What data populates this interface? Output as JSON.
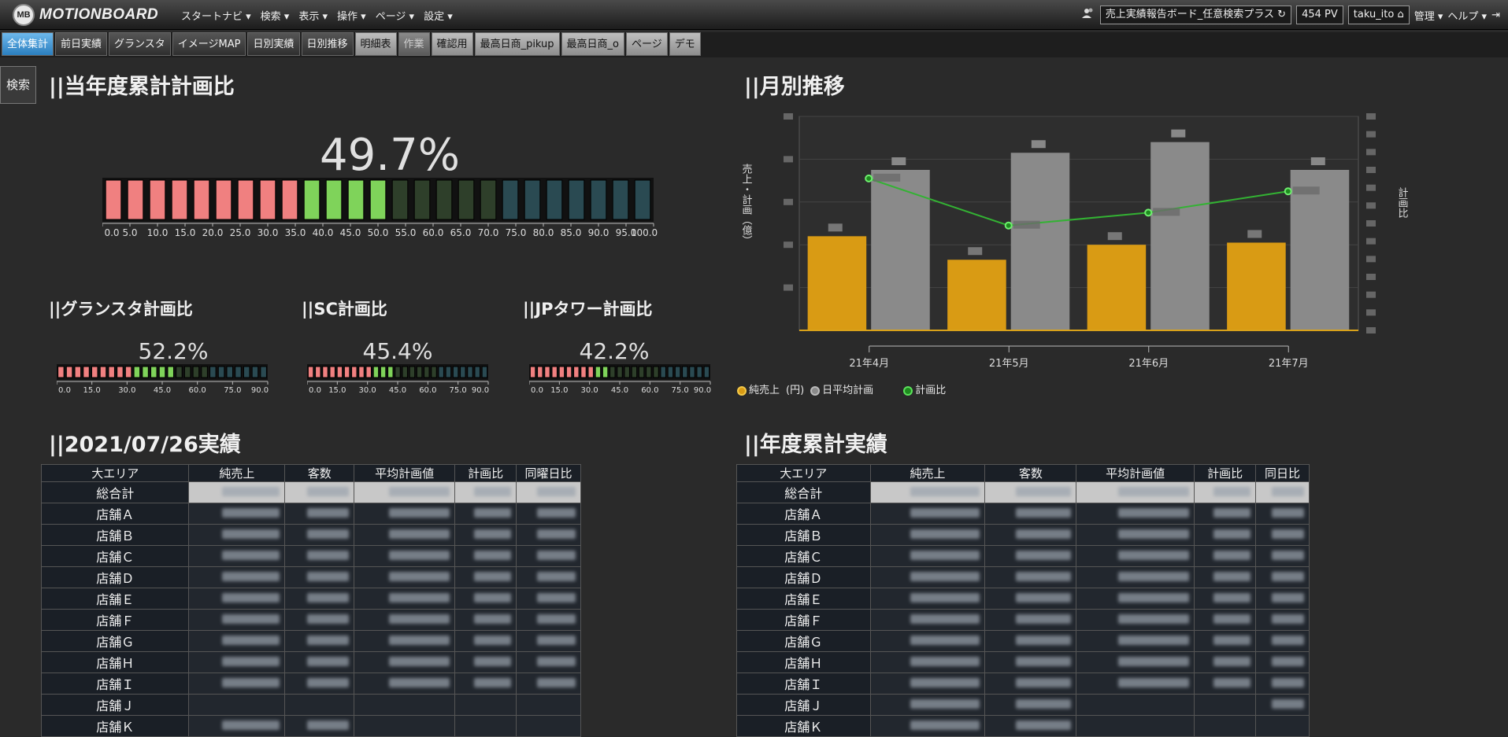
{
  "app": {
    "logo_mark": "MB",
    "logo_text": "MOTIONBOARD"
  },
  "topmenu": [
    "スタートナビ ▾",
    "検索 ▾",
    "表示 ▾",
    "操作 ▾",
    "ページ ▾",
    "設定 ▾"
  ],
  "topright": {
    "board_name": "売上実績報告ボード_任意検索プラス",
    "pv": "454 PV",
    "user": "taku_ito",
    "admin": "管理 ▾",
    "help": "ヘルプ ▾"
  },
  "tabs": [
    {
      "label": "全体集計",
      "style": "active"
    },
    {
      "label": "前日実績",
      "style": "dark"
    },
    {
      "label": "グランスタ",
      "style": "dark"
    },
    {
      "label": "イメージMAP",
      "style": "dark"
    },
    {
      "label": "日別実績",
      "style": "dark"
    },
    {
      "label": "日別推移",
      "style": "dark"
    },
    {
      "label": "明細表",
      "style": "light"
    },
    {
      "label": "作業",
      "style": "dim"
    },
    {
      "label": "確認用",
      "style": "light"
    },
    {
      "label": "最高日商_pikup",
      "style": "light"
    },
    {
      "label": "最高日商_o",
      "style": "light"
    },
    {
      "label": "ページ",
      "style": "light"
    },
    {
      "label": "デモ",
      "style": "light"
    }
  ],
  "search_button": "検索",
  "sections": {
    "ytd_plan": "||当年度累計計画比",
    "monthly": "||月別推移",
    "gransta": "||グランスタ計画比",
    "sc": "||SC計画比",
    "jp": "||JPタワー計画比",
    "daily": "||2021/07/26実績",
    "ytd_actual": "||年度累計実績"
  },
  "gauges": {
    "main": {
      "value": 49.7,
      "label": "49.7%"
    },
    "gransta": {
      "value": 52.2,
      "label": "52.2%"
    },
    "sc": {
      "value": 45.4,
      "label": "45.4%"
    },
    "jp": {
      "value": 42.2,
      "label": "42.2%"
    },
    "main_ticks": [
      "0.0",
      "5.0",
      "10.0",
      "15.0",
      "20.0",
      "25.0",
      "30.0",
      "35.0",
      "40.0",
      "45.0",
      "50.0",
      "55.0",
      "60.0",
      "65.0",
      "70.0",
      "75.0",
      "80.0",
      "85.0",
      "90.0",
      "95.0",
      "100.0"
    ],
    "small_ticks": [
      "0.0",
      "15.0",
      "30.0",
      "45.0",
      "60.0",
      "75.0",
      "90.0"
    ],
    "colors": {
      "red": "#f08080",
      "green": "#7fd35a",
      "dark_green": "#2e3f2a",
      "teal": "#2a4a52"
    }
  },
  "chart_data": {
    "type": "bar",
    "categories": [
      "21年4月",
      "21年5月",
      "21年6月",
      "21年7月"
    ],
    "series": [
      {
        "name": "純売上",
        "values": [
          0.44,
          0.33,
          0.4,
          0.41
        ],
        "color": "#d99b14"
      },
      {
        "name": "日平均計画",
        "values": [
          0.75,
          0.83,
          0.88,
          0.75
        ],
        "color": "#8a8a8a"
      },
      {
        "name": "計画比",
        "values": [
          0.71,
          0.49,
          0.55,
          0.65
        ],
        "color": "#33b233"
      }
    ],
    "ylabel": "売上・計画（億）",
    "y2label": "計画比",
    "legend_unit": "(円)"
  },
  "daily_table": {
    "headers": [
      "大エリア",
      "純売上",
      "客数",
      "平均計画値",
      "計画比",
      "同曜日比"
    ],
    "rows": [
      "総合計",
      "店舗Ａ",
      "店舗Ｂ",
      "店舗Ｃ",
      "店舗Ｄ",
      "店舗Ｅ",
      "店舗Ｆ",
      "店舗Ｇ",
      "店舗Ｈ",
      "店舗Ｉ",
      "店舗Ｊ",
      "店舗Ｋ"
    ]
  },
  "ytd_table": {
    "headers": [
      "大エリア",
      "純売上",
      "客数",
      "平均計画値",
      "計画比",
      "同日比"
    ],
    "rows": [
      "総合計",
      "店舗Ａ",
      "店舗Ｂ",
      "店舗Ｃ",
      "店舗Ｄ",
      "店舗Ｅ",
      "店舗Ｆ",
      "店舗Ｇ",
      "店舗Ｈ",
      "店舗Ｉ",
      "店舗Ｊ",
      "店舗Ｋ"
    ]
  }
}
